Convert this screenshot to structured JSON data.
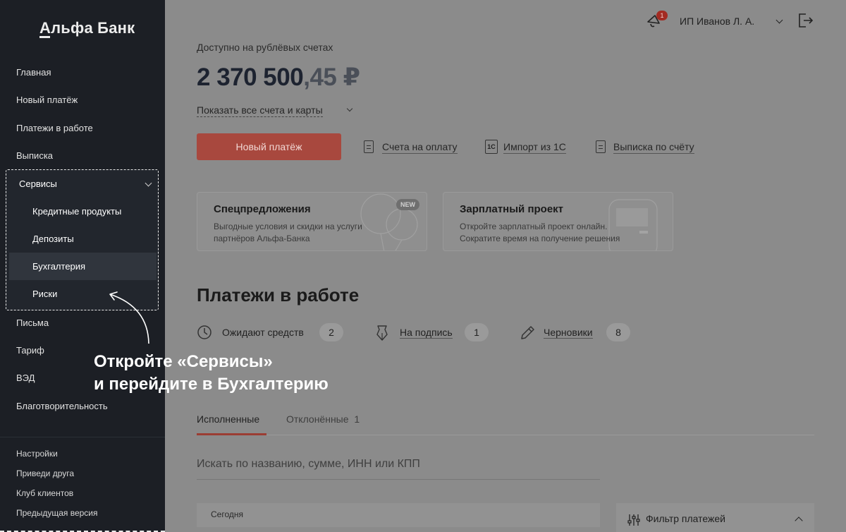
{
  "sidebar": {
    "logo": "Альфа Банк",
    "items": [
      "Главная",
      "Новый платёж",
      "Платежи в работе",
      "Выписка"
    ],
    "services": {
      "label": "Сервисы",
      "sub_items": [
        "Кредитные продукты",
        "Депозиты",
        "Бухгалтерия",
        "Риски"
      ],
      "active": "Бухгалтерия"
    },
    "items_after": [
      "Письма",
      "Тариф",
      "ВЭД",
      "Благотворительность"
    ],
    "bottom": [
      "Настройки",
      "Приведи друга",
      "Клуб клиентов",
      "Предыдущая версия"
    ]
  },
  "header": {
    "notification_count": "1",
    "user_name": "ИП Иванов Л. А."
  },
  "balance": {
    "label": "Доступно на рублёвых счетах",
    "whole": "2 370 500",
    "cents": ",45 ₽",
    "show_all": "Показать все счета и карты"
  },
  "actions": {
    "new_payment": "Новый платёж",
    "links": [
      "Счета на оплату",
      "Импорт из 1С",
      "Выписка по счёту"
    ],
    "import_icon_text": "1С"
  },
  "cards": [
    {
      "title": "Спецпредложения",
      "text": "Выгодные условия и скидки на услуги партнёров Альфа-Банка",
      "badge": "NEW"
    },
    {
      "title": "Зарплатный проект",
      "text": "Откройте зарплатный проект онлайн. Сократите время на получение решения"
    }
  ],
  "payments": {
    "title": "Платежи в работе",
    "statuses": [
      {
        "label": "Ожидают средств",
        "count": "2",
        "icon": "clock-icon"
      },
      {
        "label": "На подпись",
        "count": "1",
        "icon": "pen-nib-icon"
      },
      {
        "label": "Черновики",
        "count": "8",
        "icon": "pencil-icon"
      }
    ],
    "tabs": [
      {
        "label": "Исполненные"
      },
      {
        "label": "Отклонённые",
        "count": "1"
      }
    ],
    "search_placeholder": "Искать по названию, сумме, ИНН или КПП",
    "today": "Сегодня",
    "filter": "Фильтр платежей"
  },
  "hint": {
    "line1": "Откройте «Сервисы»",
    "line2": "и перейдите в Бухгалтерию"
  }
}
